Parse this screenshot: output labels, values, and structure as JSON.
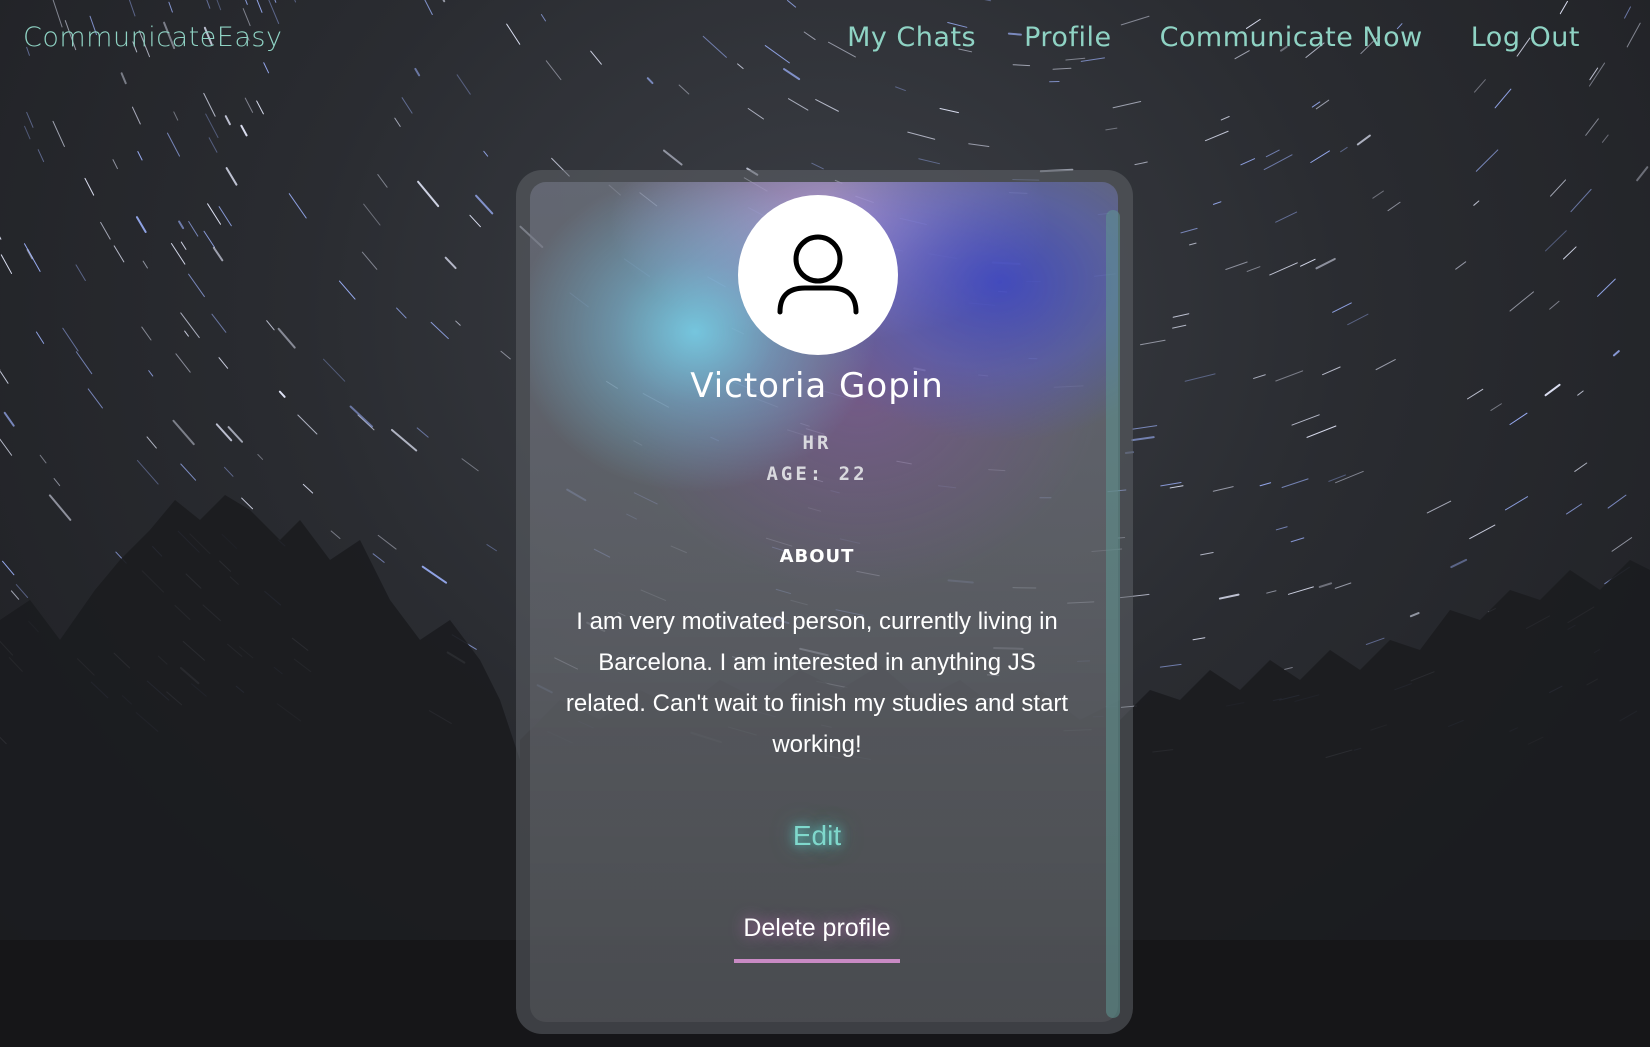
{
  "nav": {
    "brand": "CommunicateEasy",
    "links": [
      {
        "label": "My Chats"
      },
      {
        "label": "Profile"
      },
      {
        "label": "Communicate Now"
      },
      {
        "label": "Log Out"
      }
    ]
  },
  "profile": {
    "name": "Victoria Gopin",
    "role": "HR",
    "age_label": "AGE: 22",
    "about_heading": "ABOUT",
    "about_text": "I am very motivated person, currently living in Barcelona. I am interested in anything JS related. Can't wait to finish my studies and start working!",
    "avatar_icon": "user-icon",
    "edit_label": "Edit",
    "delete_label": "Delete profile"
  },
  "colors": {
    "accent_teal": "#8fd3c4",
    "edit_glow": "#7fd8cc",
    "delete_underline": "#c98ac4"
  }
}
